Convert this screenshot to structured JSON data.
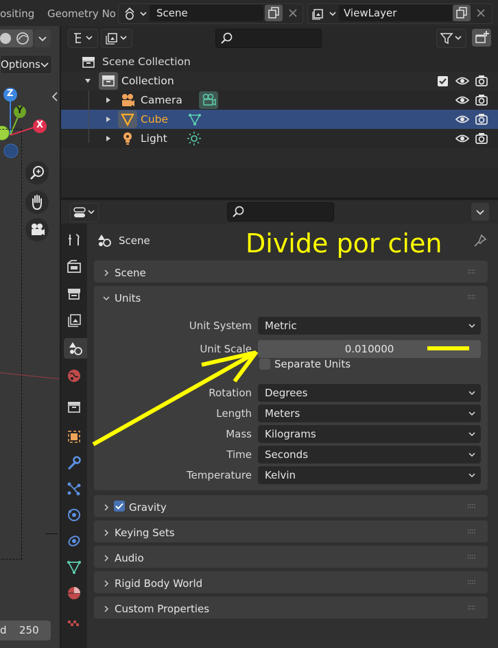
{
  "topbar": {
    "tab_compositing": "ositing",
    "tab_geometry": "Geometry No",
    "scene_name": "Scene",
    "viewlayer_name": "ViewLayer"
  },
  "viewport": {
    "options_label": "Options",
    "gizmo_z": "Z",
    "gizmo_y": "Y",
    "gizmo_x": "X",
    "end_label": "d",
    "end_value": "250"
  },
  "outliner": {
    "scene_collection": "Scene Collection",
    "collection": "Collection",
    "items": [
      {
        "label": "Camera"
      },
      {
        "label": "Cube"
      },
      {
        "label": "Light"
      }
    ]
  },
  "properties": {
    "context_title": "Scene",
    "annotation": "Divide por cien",
    "panels": {
      "scene": "Scene",
      "units": "Units",
      "gravity": "Gravity",
      "keying_sets": "Keying Sets",
      "audio": "Audio",
      "rigid_body_world": "Rigid Body World",
      "custom_properties": "Custom Properties"
    },
    "units": {
      "unit_system_label": "Unit System",
      "unit_system_value": "Metric",
      "unit_scale_label": "Unit Scale",
      "unit_scale_value": "0.010000",
      "separate_units_label": "Separate Units",
      "rotation_label": "Rotation",
      "rotation_value": "Degrees",
      "length_label": "Length",
      "length_value": "Meters",
      "mass_label": "Mass",
      "mass_value": "Kilograms",
      "time_label": "Time",
      "time_value": "Seconds",
      "temperature_label": "Temperature",
      "temperature_value": "Kelvin"
    }
  },
  "colors": {
    "selection": "#334d80",
    "accent": "#4772b3",
    "annotation": "#ffff00",
    "cube_label": "#ffaf29"
  }
}
